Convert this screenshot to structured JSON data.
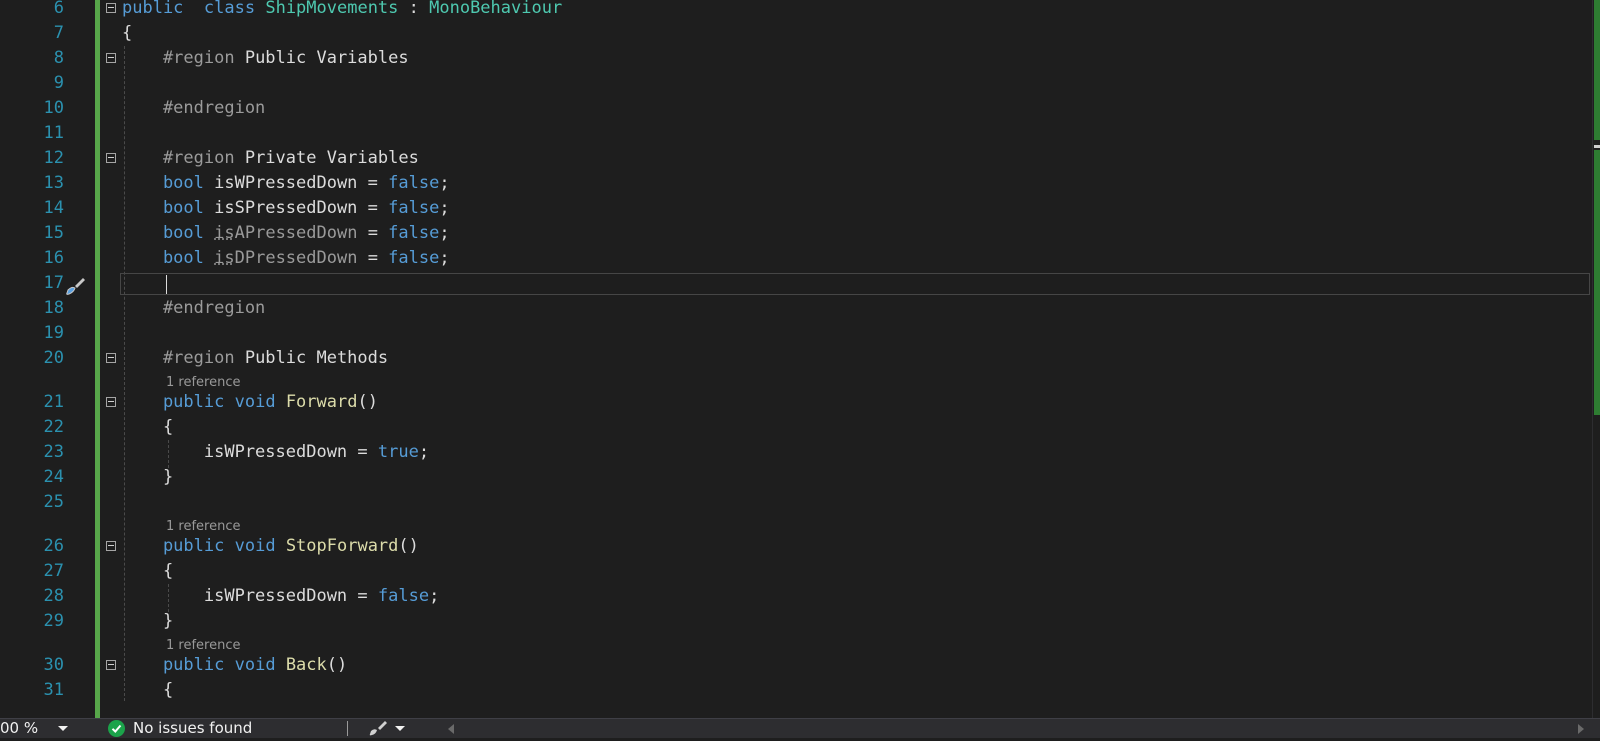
{
  "colors": {
    "background": "#1e1e1e",
    "line_number": "#2b91af",
    "keyword": "#569cd6",
    "type_name": "#4ec9b0",
    "method_name": "#dcdcaa",
    "text": "#dcdcdc",
    "preprocessor": "#9b9b9b",
    "change_bar": "#57a64a",
    "issues_ok": "#1ba34a"
  },
  "editor": {
    "lines": [
      {
        "num": "6",
        "parts": [
          [
            "kw",
            "public"
          ],
          [
            "",
            "  "
          ],
          [
            "kw",
            "class"
          ],
          [
            "",
            " "
          ],
          [
            "cls",
            "ShipMovements"
          ],
          [
            "",
            " : "
          ],
          [
            "cls",
            "MonoBehaviour"
          ]
        ]
      },
      {
        "num": "7",
        "parts": [
          [
            "",
            "{"
          ]
        ]
      },
      {
        "num": "8",
        "parts": [
          [
            "pp",
            "    #region"
          ],
          [
            "",
            " Public Variables"
          ]
        ]
      },
      {
        "num": "9",
        "parts": []
      },
      {
        "num": "10",
        "parts": [
          [
            "pp",
            "    #endregion"
          ]
        ]
      },
      {
        "num": "11",
        "parts": []
      },
      {
        "num": "12",
        "parts": [
          [
            "pp",
            "    #region"
          ],
          [
            "",
            " Private Variables"
          ]
        ]
      },
      {
        "num": "13",
        "parts": [
          [
            "kw",
            "    bool"
          ],
          [
            "",
            " isWPressedDown = "
          ],
          [
            "kw",
            "false"
          ],
          [
            "",
            ";"
          ]
        ]
      },
      {
        "num": "14",
        "parts": [
          [
            "kw",
            "    bool"
          ],
          [
            "",
            " isSPressedDown = "
          ],
          [
            "kw",
            "false"
          ],
          [
            "",
            ";"
          ]
        ]
      },
      {
        "num": "15",
        "parts": [
          [
            "kw",
            "    bool"
          ],
          [
            "",
            " "
          ],
          [
            "dim dots",
            "is"
          ],
          [
            "dim",
            "APressedDown"
          ],
          [
            "",
            " = "
          ],
          [
            "kw",
            "false"
          ],
          [
            "",
            ";"
          ]
        ]
      },
      {
        "num": "16",
        "parts": [
          [
            "kw",
            "    bool"
          ],
          [
            "",
            " "
          ],
          [
            "dim dots",
            "is"
          ],
          [
            "dim",
            "DPressedDown"
          ],
          [
            "",
            " = "
          ],
          [
            "kw",
            "false"
          ],
          [
            "",
            ";"
          ]
        ]
      },
      {
        "num": "17",
        "parts": []
      },
      {
        "num": "18",
        "parts": [
          [
            "pp",
            "    #endregion"
          ]
        ]
      },
      {
        "num": "19",
        "parts": []
      },
      {
        "num": "20",
        "parts": [
          [
            "pp",
            "    #region"
          ],
          [
            "",
            " Public Methods"
          ]
        ]
      },
      {
        "num": "21",
        "parts": [
          [
            "kw",
            "    public"
          ],
          [
            "",
            " "
          ],
          [
            "kw",
            "void"
          ],
          [
            "",
            " "
          ],
          [
            "fn",
            "Forward"
          ],
          [
            "",
            "()"
          ]
        ]
      },
      {
        "num": "22",
        "parts": [
          [
            "",
            "    {"
          ]
        ]
      },
      {
        "num": "23",
        "parts": [
          [
            "",
            "        isWPressedDown = "
          ],
          [
            "kw",
            "true"
          ],
          [
            "",
            ";"
          ]
        ]
      },
      {
        "num": "24",
        "parts": [
          [
            "",
            "    }"
          ]
        ]
      },
      {
        "num": "25",
        "parts": []
      },
      {
        "num": "26",
        "parts": [
          [
            "kw",
            "    public"
          ],
          [
            "",
            " "
          ],
          [
            "kw",
            "void"
          ],
          [
            "",
            " "
          ],
          [
            "fn",
            "StopForward"
          ],
          [
            "",
            "()"
          ]
        ]
      },
      {
        "num": "27",
        "parts": [
          [
            "",
            "    {"
          ]
        ]
      },
      {
        "num": "28",
        "parts": [
          [
            "",
            "        isWPressedDown = "
          ],
          [
            "kw",
            "false"
          ],
          [
            "",
            ";"
          ]
        ]
      },
      {
        "num": "29",
        "parts": [
          [
            "",
            "    }"
          ]
        ]
      },
      {
        "num": "30",
        "parts": [
          [
            "kw",
            "    public"
          ],
          [
            "",
            " "
          ],
          [
            "kw",
            "void"
          ],
          [
            "",
            " "
          ],
          [
            "fn",
            "Back"
          ],
          [
            "",
            "()"
          ]
        ]
      },
      {
        "num": "31",
        "parts": [
          [
            "",
            "    {"
          ]
        ]
      }
    ],
    "codelens": [
      "1 reference",
      "1 reference",
      "1 reference"
    ]
  },
  "status_bar": {
    "zoom": "00 %",
    "issues": "No issues found"
  }
}
